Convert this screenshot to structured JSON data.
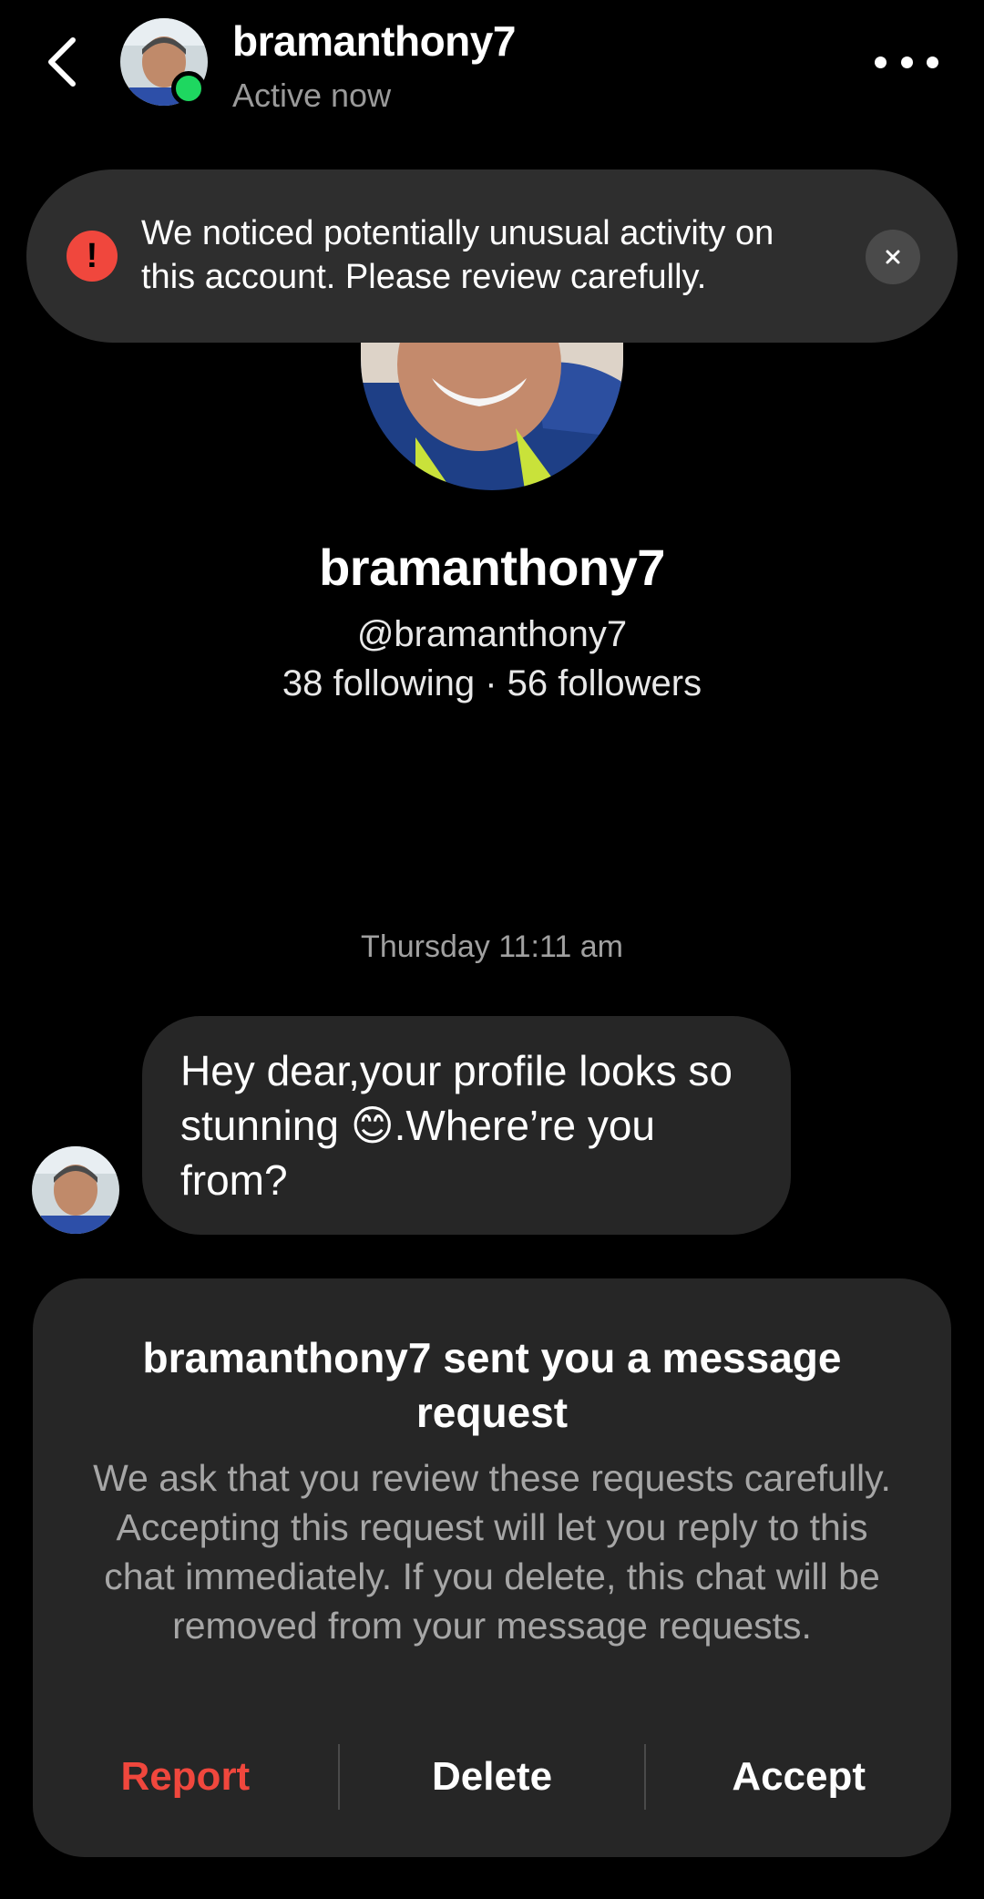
{
  "header": {
    "username": "bramanthony7",
    "status": "Active now"
  },
  "banner": {
    "text": "We noticed potentially unusual activity on this account. Please review carefully.",
    "icon_glyph": "!",
    "close_glyph": "×"
  },
  "profile": {
    "name": "bramanthony7",
    "handle": "@bramanthony7",
    "stats": "38 following · 56 followers"
  },
  "conversation": {
    "timestamp": "Thursday 11:11 am",
    "message": "Hey dear,your profile looks so stunning 😊.Where’re you from?"
  },
  "request": {
    "title": "bramanthony7 sent you a message request",
    "body": "We ask that you review these requests carefully. Accepting this request will let you reply to this chat immediately. If you delete, this chat will be removed from your message requests.",
    "report_label": "Report",
    "delete_label": "Delete",
    "accept_label": "Accept"
  },
  "colors": {
    "background": "#000000",
    "surface": "#262626",
    "banner": "#2e2e2e",
    "online": "#1ed760",
    "danger": "#f0473d",
    "muted_text": "#a6a6a6"
  }
}
